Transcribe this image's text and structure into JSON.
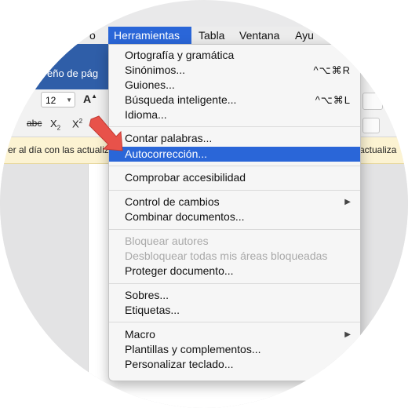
{
  "menubar": {
    "items": [
      {
        "label": "o"
      },
      {
        "label": "Herramientas"
      },
      {
        "label": "Tabla"
      },
      {
        "label": "Ventana"
      },
      {
        "label": "Ayu"
      }
    ]
  },
  "ribbon": {
    "group_label": "eño de pág",
    "font_size": "12"
  },
  "toolbar": {
    "grow_font": "A",
    "strikethrough": "abc",
    "subscript": "X",
    "subscript_mark": "2",
    "superscript": "X",
    "superscript_mark": "2"
  },
  "notice": {
    "left_text": "er al día con las actualiz",
    "right_text": "actualiza"
  },
  "menu": {
    "ortografia": "Ortografía y gramática",
    "sinonimos": "Sinónimos...",
    "sinonimos_shortcut": "^⌥⌘R",
    "guiones": "Guiones...",
    "busqueda": "Búsqueda inteligente...",
    "busqueda_shortcut": "^⌥⌘L",
    "idioma": "Idioma...",
    "contar": "Contar palabras...",
    "autocorreccion": "Autocorrección...",
    "comprobar": "Comprobar accesibilidad",
    "control": "Control de cambios",
    "combinar": "Combinar documentos...",
    "bloquear": "Bloquear autores",
    "desbloquear": "Desbloquear todas mis áreas bloqueadas",
    "proteger": "Proteger documento...",
    "sobres": "Sobres...",
    "etiquetas": "Etiquetas...",
    "macro": "Macro",
    "plantillas": "Plantillas y complementos...",
    "personalizar": "Personalizar teclado...",
    "submenu_arrow": "▶"
  },
  "colors": {
    "highlight": "#2a66d8",
    "ribbon_blue": "#2f5ea8",
    "pointer_red": "#e8524a"
  }
}
